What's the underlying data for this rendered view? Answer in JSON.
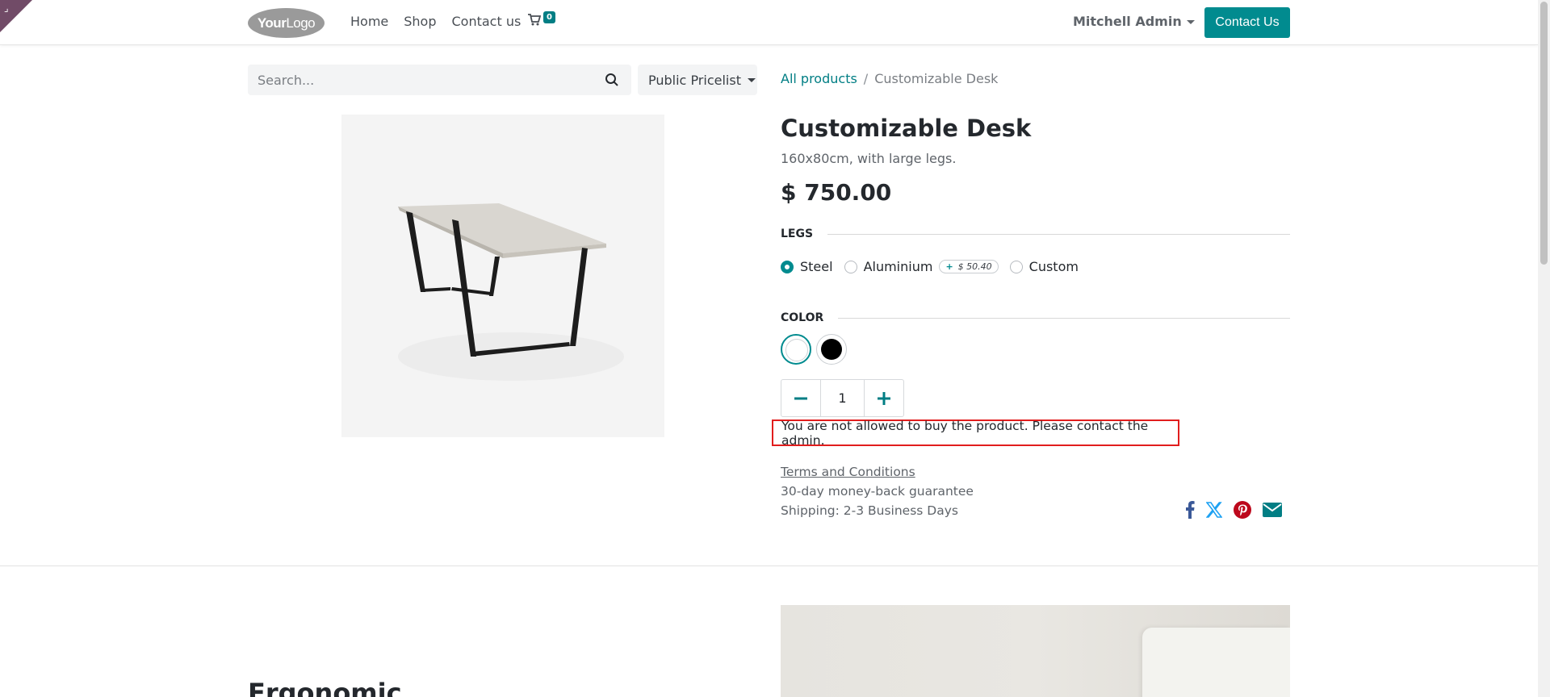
{
  "header": {
    "logo": {
      "bold": "Your",
      "light": "Logo"
    },
    "nav": [
      "Home",
      "Shop",
      "Contact us"
    ],
    "cart_count": "0",
    "user_name": "Mitchell Admin",
    "contact_button": "Contact Us"
  },
  "search": {
    "placeholder": "Search...",
    "value": ""
  },
  "pricelist": {
    "label": "Public Pricelist"
  },
  "breadcrumb": {
    "parent": "All products",
    "current": "Customizable Desk"
  },
  "product": {
    "name": "Customizable Desk",
    "description": "160x80cm, with large legs.",
    "price": "$ 750.00",
    "attributes": {
      "legs": {
        "title": "LEGS",
        "options": [
          {
            "label": "Steel",
            "selected": true
          },
          {
            "label": "Aluminium",
            "extra": "$ 50.40",
            "selected": false
          },
          {
            "label": "Custom",
            "selected": false
          }
        ]
      },
      "color": {
        "title": "COLOR",
        "swatches": [
          {
            "name": "White",
            "color": "#ffffff",
            "selected": true
          },
          {
            "name": "Black",
            "color": "#000000",
            "selected": false
          }
        ]
      }
    },
    "quantity": "1",
    "alert": "You are not allowed to buy the product. Please contact the admin.",
    "terms": "Terms and Conditions",
    "guarantee": "30-day money-back guarantee",
    "shipping": "Shipping: 2-3 Business Days"
  },
  "section": {
    "title": "Ergonomic"
  },
  "colors": {
    "primary": "#018b8f",
    "brand_corner": "#714b67",
    "alert_border": "#e11d1d"
  }
}
